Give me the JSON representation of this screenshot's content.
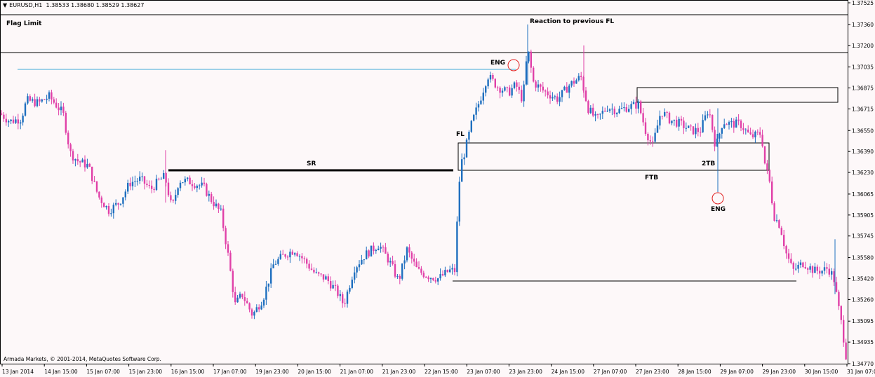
{
  "header": {
    "symbol": "EURUSD,H1",
    "ohlc": "1.38533 1.38680 1.38529 1.38627",
    "menu_icon": "triangle-down-icon"
  },
  "footer": {
    "copyright": "Armada Markets, © 2001-2014, MetaQuotes Software Corp."
  },
  "annotations": {
    "flag_limit": "Flag Limit",
    "reaction": "Reaction to previous FL",
    "eng_top": "ENG",
    "fl": "FL",
    "sr": "SR",
    "ftb": "FTB",
    "two_tb": "2TB",
    "eng_bottom": "ENG"
  },
  "colors": {
    "background": "#fdf8f9",
    "bull_candle": "#1f6fbf",
    "bear_candle": "#e040a8",
    "line": "#000000",
    "reference_line": "#3fa9d6",
    "marker_circle": "#e02020"
  },
  "chart_data": {
    "type": "candlestick",
    "instrument": "EURUSD",
    "timeframe": "H1",
    "y_ticks": [
      1.37525,
      1.3736,
      1.372,
      1.37035,
      1.36875,
      1.36715,
      1.3655,
      1.3639,
      1.3623,
      1.36065,
      1.35905,
      1.35745,
      1.3558,
      1.3542,
      1.3526,
      1.35095,
      1.34935,
      1.3477
    ],
    "x_ticks": [
      "13 Jan 2014",
      "14 Jan 15:00",
      "15 Jan 07:00",
      "15 Jan 23:00",
      "16 Jan 15:00",
      "17 Jan 07:00",
      "19 Jan 23:00",
      "20 Jan 15:00",
      "21 Jan 07:00",
      "21 Jan 23:00",
      "22 Jan 15:00",
      "23 Jan 07:00",
      "23 Jan 23:00",
      "24 Jan 15:00",
      "27 Jan 07:00",
      "27 Jan 23:00",
      "28 Jan 15:00",
      "29 Jan 07:00",
      "29 Jan 23:00",
      "30 Jan 15:00",
      "31 Jan 07:00"
    ],
    "ylim": [
      1.4762,
      1.3752
    ],
    "levels": {
      "flag_limit_lower": 1.37185,
      "reference_line": 1.37025,
      "sr_level": 1.3625,
      "fl_zone_top": 1.3646,
      "fl_zone_bottom": 1.3624,
      "upper_box_top": 1.3685,
      "upper_box_bottom": 1.3674,
      "base_line": 1.35405
    },
    "price_path": [
      [
        0,
        1.3668
      ],
      [
        14,
        1.3662
      ],
      [
        30,
        1.3664
      ],
      [
        38,
        1.3678
      ],
      [
        55,
        1.3676
      ],
      [
        70,
        1.3681
      ],
      [
        90,
        1.3668
      ],
      [
        100,
        1.3638
      ],
      [
        110,
        1.3632
      ],
      [
        126,
        1.3628
      ],
      [
        140,
        1.3605
      ],
      [
        155,
        1.3594
      ],
      [
        170,
        1.36
      ],
      [
        185,
        1.3615
      ],
      [
        200,
        1.3618
      ],
      [
        215,
        1.361
      ],
      [
        225,
        1.3616
      ],
      [
        235,
        1.362
      ],
      [
        245,
        1.3595
      ],
      [
        255,
        1.3617
      ],
      [
        270,
        1.3616
      ],
      [
        290,
        1.3612
      ],
      [
        300,
        1.3603
      ],
      [
        315,
        1.3592
      ],
      [
        325,
        1.356
      ],
      [
        335,
        1.3522
      ],
      [
        345,
        1.353
      ],
      [
        360,
        1.3514
      ],
      [
        375,
        1.3527
      ],
      [
        390,
        1.3553
      ],
      [
        405,
        1.356
      ],
      [
        420,
        1.3564
      ],
      [
        435,
        1.3555
      ],
      [
        450,
        1.3545
      ],
      [
        465,
        1.3542
      ],
      [
        480,
        1.3532
      ],
      [
        490,
        1.3522
      ],
      [
        505,
        1.355
      ],
      [
        520,
        1.356
      ],
      [
        540,
        1.3568
      ],
      [
        555,
        1.3555
      ],
      [
        568,
        1.354
      ],
      [
        580,
        1.3564
      ],
      [
        595,
        1.3548
      ],
      [
        610,
        1.3544
      ],
      [
        625,
        1.3542
      ],
      [
        640,
        1.3548
      ],
      [
        648,
        1.3548
      ],
      [
        652,
        1.359
      ],
      [
        656,
        1.3628
      ],
      [
        662,
        1.3638
      ],
      [
        672,
        1.366
      ],
      [
        685,
        1.368
      ],
      [
        695,
        1.3697
      ],
      [
        710,
        1.3688
      ],
      [
        725,
        1.3684
      ],
      [
        735,
        1.369
      ],
      [
        745,
        1.3678
      ],
      [
        752,
        1.3718
      ],
      [
        760,
        1.3692
      ],
      [
        775,
        1.3685
      ],
      [
        795,
        1.3679
      ],
      [
        812,
        1.369
      ],
      [
        828,
        1.3696
      ],
      [
        838,
        1.3672
      ],
      [
        850,
        1.3663
      ],
      [
        865,
        1.3673
      ],
      [
        880,
        1.367
      ],
      [
        895,
        1.3673
      ],
      [
        910,
        1.3675
      ],
      [
        920,
        1.3655
      ],
      [
        930,
        1.3643
      ],
      [
        942,
        1.367
      ],
      [
        955,
        1.3663
      ],
      [
        970,
        1.366
      ],
      [
        985,
        1.3655
      ],
      [
        998,
        1.3655
      ],
      [
        1010,
        1.3672
      ],
      [
        1020,
        1.3642
      ],
      [
        1030,
        1.3662
      ],
      [
        1040,
        1.366
      ],
      [
        1055,
        1.366
      ],
      [
        1070,
        1.365
      ],
      [
        1085,
        1.3653
      ],
      [
        1090,
        1.363
      ],
      [
        1097,
        1.3615
      ],
      [
        1103,
        1.359
      ],
      [
        1112,
        1.3582
      ],
      [
        1120,
        1.3562
      ],
      [
        1130,
        1.3548
      ],
      [
        1145,
        1.3554
      ],
      [
        1160,
        1.3548
      ],
      [
        1172,
        1.3548
      ],
      [
        1180,
        1.355
      ],
      [
        1188,
        1.3543
      ],
      [
        1195,
        1.352
      ],
      [
        1200,
        1.3505
      ],
      [
        1206,
        1.3482
      ]
    ]
  }
}
